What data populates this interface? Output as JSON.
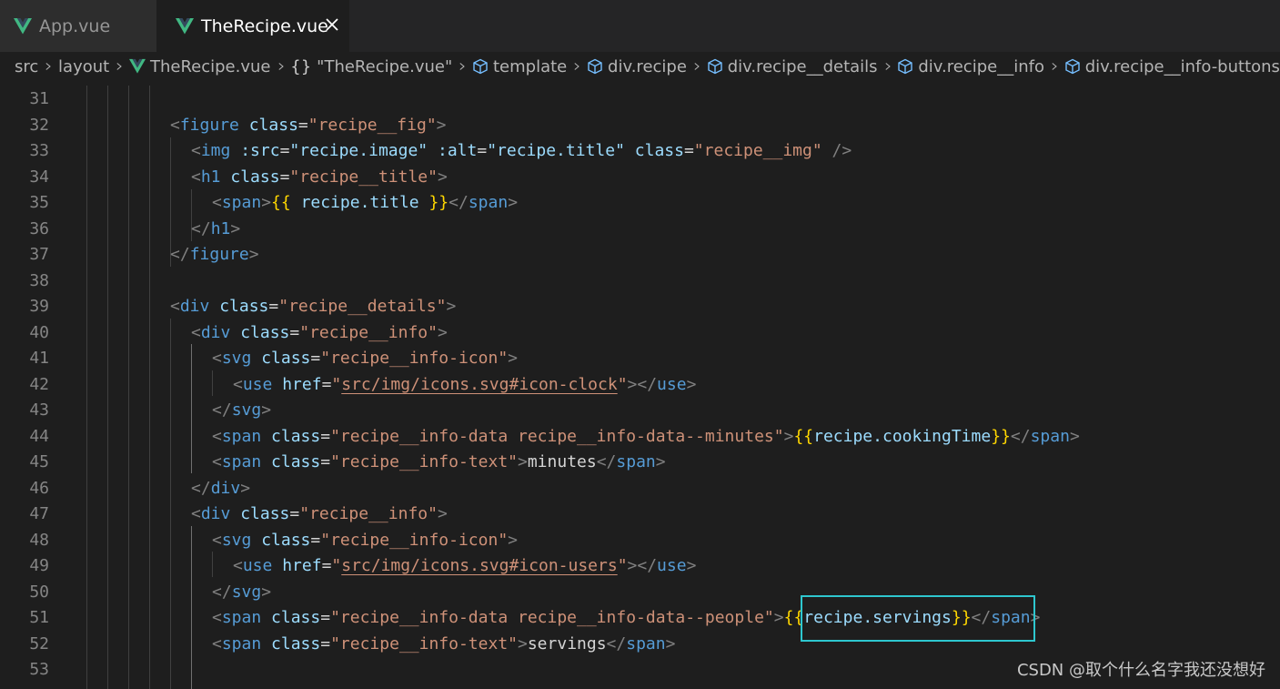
{
  "tabs": [
    {
      "label": "App.vue",
      "active": false,
      "icon": "vue-logo-icon"
    },
    {
      "label": "TheRecipe.vue",
      "active": true,
      "icon": "vue-logo-icon",
      "close_icon": "close-icon"
    }
  ],
  "breadcrumb": {
    "segments": [
      "src",
      "layout",
      "TheRecipe.vue",
      "\"TheRecipe.vue\"",
      "template",
      "div.recipe",
      "div.recipe__details",
      "div.recipe__info",
      "div.recipe__info-buttons"
    ],
    "braces": "{}"
  },
  "editor": {
    "lines": [
      {
        "num": "31"
      },
      {
        "num": "32"
      },
      {
        "num": "33"
      },
      {
        "num": "34"
      },
      {
        "num": "35"
      },
      {
        "num": "36"
      },
      {
        "num": "37"
      },
      {
        "num": "38"
      },
      {
        "num": "39"
      },
      {
        "num": "40"
      },
      {
        "num": "41"
      },
      {
        "num": "42"
      },
      {
        "num": "43"
      },
      {
        "num": "44"
      },
      {
        "num": "45"
      },
      {
        "num": "46"
      },
      {
        "num": "47"
      },
      {
        "num": "48"
      },
      {
        "num": "49"
      },
      {
        "num": "50"
      },
      {
        "num": "51"
      },
      {
        "num": "52"
      },
      {
        "num": "53"
      }
    ],
    "code": {
      "l32": {
        "tag": "figure",
        "attr": "class",
        "val": "recipe__fig"
      },
      "l33": {
        "tag": "img",
        "a1": ":src",
        "v1": "recipe.image",
        "a2": ":alt",
        "v2": "recipe.title",
        "a3": "class",
        "v3": "recipe__img",
        "end": " />"
      },
      "l34": {
        "tag": "h1",
        "attr": "class",
        "val": "recipe__title"
      },
      "l35": {
        "tag": "span",
        "open": "{{",
        "expr": " recipe.title ",
        "close": "}}"
      },
      "l36": {
        "tag": "h1"
      },
      "l37": {
        "tag": "figure"
      },
      "l39": {
        "tag": "div",
        "attr": "class",
        "val": "recipe__details"
      },
      "l40": {
        "tag": "div",
        "attr": "class",
        "val": "recipe__info"
      },
      "l41": {
        "tag": "svg",
        "attr": "class",
        "val": "recipe__info-icon"
      },
      "l42": {
        "tag": "use",
        "attr": "href",
        "val": "src/img/icons.svg#icon-clock"
      },
      "l43": {
        "tag": "svg"
      },
      "l44": {
        "tag": "span",
        "attr": "class",
        "val": "recipe__info-data recipe__info-data--minutes",
        "open": "{{",
        "expr": "recipe.cookingTime",
        "close": "}}"
      },
      "l45": {
        "tag": "span",
        "attr": "class",
        "val": "recipe__info-text",
        "text": "minutes"
      },
      "l46": {
        "tag": "div"
      },
      "l47": {
        "tag": "div",
        "attr": "class",
        "val": "recipe__info"
      },
      "l48": {
        "tag": "svg",
        "attr": "class",
        "val": "recipe__info-icon"
      },
      "l49": {
        "tag": "use",
        "attr": "href",
        "val": "src/img/icons.svg#icon-users"
      },
      "l50": {
        "tag": "svg"
      },
      "l51": {
        "tag": "span",
        "attr": "class",
        "val": "recipe__info-data recipe__info-data--people",
        "open": "{{",
        "expr": "recipe.servings",
        "close": "}}"
      },
      "l52": {
        "tag": "span",
        "attr": "class",
        "val": "recipe__info-text",
        "text": "servings"
      }
    }
  },
  "watermark": "CSDN @取个什么名字我还没想好",
  "colors": {
    "background": "#1e1e1e",
    "tag": "#569cd6",
    "attr": "#9cdcfe",
    "string": "#ce9178",
    "mustache": "#ffd700",
    "line_number": "#858585",
    "highlight_box": "#2ec7cf"
  }
}
